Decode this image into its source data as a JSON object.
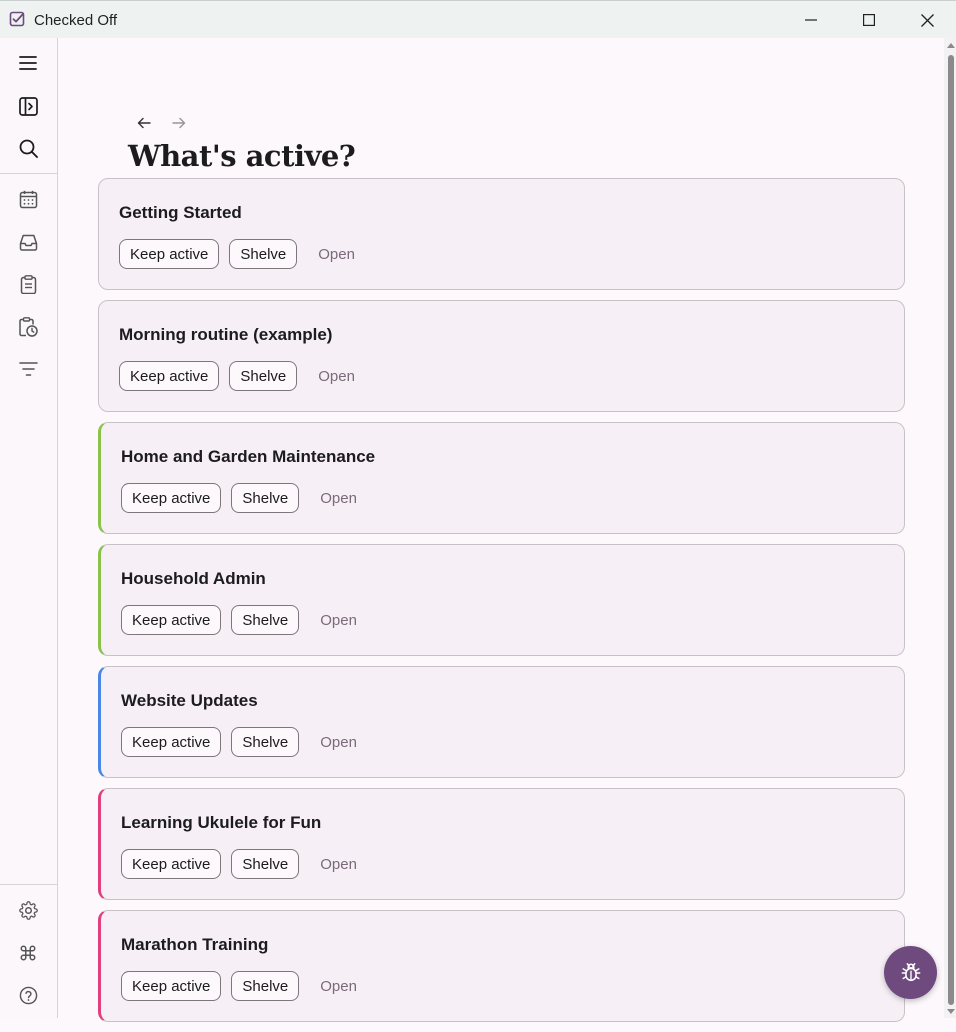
{
  "window": {
    "title": "Checked Off",
    "icon": "checkbox-icon",
    "controls": [
      "minimize-icon",
      "maximize-icon",
      "close-icon"
    ]
  },
  "sidebar": {
    "top_items": [
      {
        "name": "menu",
        "icon": "hamburger-icon"
      },
      {
        "name": "toggle-panel",
        "icon": "panel-icon"
      },
      {
        "name": "search",
        "icon": "search-icon"
      }
    ],
    "nav_items": [
      {
        "name": "calendar",
        "icon": "calendar-icon"
      },
      {
        "name": "inbox",
        "icon": "inbox-icon"
      },
      {
        "name": "clipboard",
        "icon": "clipboard-icon"
      },
      {
        "name": "scheduled",
        "icon": "clipboard-clock-icon"
      },
      {
        "name": "filter",
        "icon": "filter-icon"
      }
    ],
    "bottom_items": [
      {
        "name": "settings",
        "icon": "gear-icon"
      },
      {
        "name": "shortcuts",
        "icon": "command-icon"
      },
      {
        "name": "help",
        "icon": "help-icon"
      }
    ]
  },
  "page": {
    "title": "What's active?",
    "back_icon": "arrow-left-icon",
    "forward_icon": "arrow-right-icon"
  },
  "cards": [
    {
      "title": "Getting Started",
      "accent": "",
      "keep": "Keep active",
      "shelve": "Shelve",
      "open": "Open"
    },
    {
      "title": "Morning routine (example)",
      "accent": "",
      "keep": "Keep active",
      "shelve": "Shelve",
      "open": "Open"
    },
    {
      "title": "Home and Garden Maintenance",
      "accent": "#8bc34a",
      "keep": "Keep active",
      "shelve": "Shelve",
      "open": "Open"
    },
    {
      "title": "Household Admin",
      "accent": "#8bc34a",
      "keep": "Keep active",
      "shelve": "Shelve",
      "open": "Open"
    },
    {
      "title": "Website Updates",
      "accent": "#4a86e8",
      "keep": "Keep active",
      "shelve": "Shelve",
      "open": "Open"
    },
    {
      "title": "Learning Ukulele for Fun",
      "accent": "#e0407e",
      "keep": "Keep active",
      "shelve": "Shelve",
      "open": "Open"
    },
    {
      "title": "Marathon Training",
      "accent": "#e0407e",
      "keep": "Keep active",
      "shelve": "Shelve",
      "open": "Open"
    }
  ],
  "fab": {
    "icon": "bug-icon"
  },
  "colors": {
    "primary": "#6e4a7e",
    "background": "#fcf8fc",
    "card": "#f6f0f6"
  }
}
